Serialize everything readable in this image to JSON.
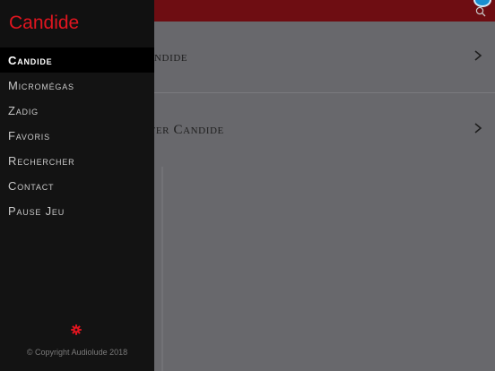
{
  "app": {
    "title": "Candide",
    "copyright": "© Copyright Audiolude 2018"
  },
  "colors": {
    "accent": "#e0151f",
    "topbar": "#6e0d12",
    "drawer_bg": "#131313",
    "badge_blue": "#1a8fd0"
  },
  "menu": {
    "items": [
      {
        "label": "Candide",
        "active": true
      },
      {
        "label": "Micromégas",
        "active": false
      },
      {
        "label": "Zadig",
        "active": false
      },
      {
        "label": "Favoris",
        "active": false
      },
      {
        "label": "Rechercher",
        "active": false
      },
      {
        "label": "Contact",
        "active": false
      },
      {
        "label": "Pause Jeu",
        "active": false
      }
    ]
  },
  "list": {
    "rows": [
      {
        "label": "ndide"
      },
      {
        "label": "uter Candide"
      }
    ]
  },
  "icons": {
    "search": "search-icon",
    "gear": "gear-icon",
    "chevron": "chevron-right-icon"
  }
}
